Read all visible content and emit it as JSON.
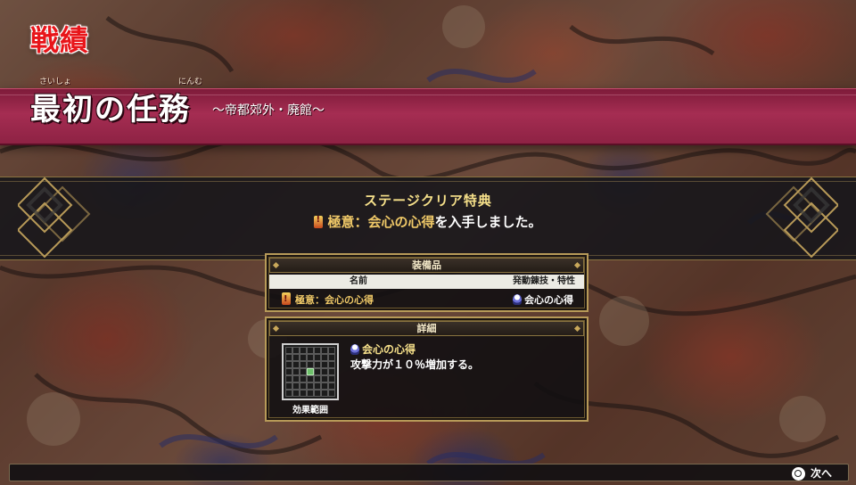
{
  "header": {
    "screen_title": "戦績",
    "mission_name": "最初の任務",
    "mission_furigana_left": "さいしょ",
    "mission_furigana_right": "にんむ",
    "mission_subtitle": "〜帝都郊外・廃館〜"
  },
  "reward": {
    "heading": "ステージクリア特典",
    "item_name": "極意：会心の心得",
    "message_suffix": "を入手しました。"
  },
  "equipment_panel": {
    "title": "装備品",
    "col_name": "名前",
    "col_skill": "発動錬技・特性",
    "row_name": "極意：会心の心得",
    "row_skill": "会心の心得"
  },
  "detail_panel": {
    "title": "詳細",
    "skill_name": "会心の心得",
    "description": "攻撃力が１０％増加する。",
    "range_label": "効果範囲",
    "range_grid_size": 7,
    "range_active_cell": [
      3,
      3
    ]
  },
  "footer": {
    "next_label": "次へ",
    "next_icon": "circle-button-icon"
  },
  "colors": {
    "title_red": "#e8151a",
    "banner": "#a52d52",
    "gold": "#f6e08a",
    "range_on": "#6dc06a"
  }
}
